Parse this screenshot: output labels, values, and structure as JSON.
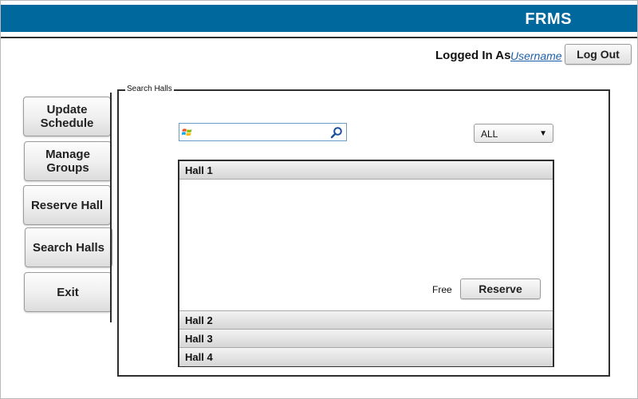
{
  "header": {
    "brand": "FRMS",
    "brand_color": "#00689c"
  },
  "user": {
    "logged_in_label": "Logged In As",
    "username": "Username",
    "logout_label": "Log Out"
  },
  "nav": {
    "items": [
      {
        "label": "Update Schedule"
      },
      {
        "label": "Manage Groups"
      },
      {
        "label": "Reserve Hall"
      },
      {
        "label": "Search Halls"
      },
      {
        "label": "Exit"
      }
    ]
  },
  "search_panel": {
    "legend": "Search Halls",
    "search": {
      "value": "",
      "placeholder": ""
    },
    "filter": {
      "selected": "ALL"
    }
  },
  "halls": [
    {
      "name": "Hall 1",
      "expanded": true,
      "status": "Free",
      "action_label": "Reserve"
    },
    {
      "name": "Hall 2",
      "expanded": false
    },
    {
      "name": "Hall 3",
      "expanded": false
    },
    {
      "name": "Hall 4",
      "expanded": false
    }
  ],
  "icons": {
    "search_provider": "windows-logo-icon",
    "search": "magnifier-icon",
    "dropdown": "caret-down-icon"
  }
}
